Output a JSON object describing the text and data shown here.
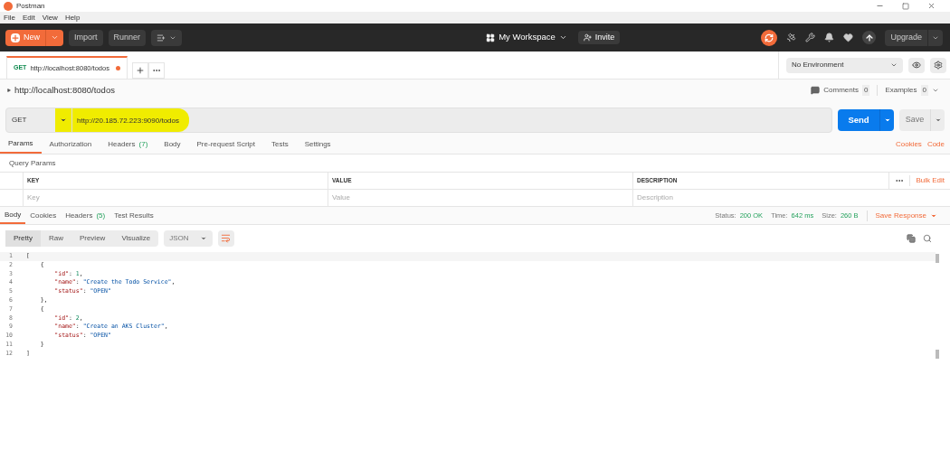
{
  "window": {
    "title": "Postman"
  },
  "menu": [
    "File",
    "Edit",
    "View",
    "Help"
  ],
  "toolbar": {
    "new": "New",
    "import": "Import",
    "runner": "Runner",
    "workspace": "My Workspace",
    "invite": "Invite",
    "upgrade": "Upgrade"
  },
  "request_tabs": [
    {
      "method": "GET",
      "url": "http://localhost:8080/todos",
      "selected": true,
      "unsaved": true
    }
  ],
  "environment": "No Environment",
  "request_title": "http://localhost:8080/todos",
  "comments": {
    "label": "Comments",
    "count": "0"
  },
  "examples": {
    "label": "Examples",
    "count": "0"
  },
  "request": {
    "method": "GET",
    "url": "http://20.185.72.223:9090/todos",
    "highlighted": true
  },
  "send": "Send",
  "save": "Save",
  "request_sections": [
    {
      "label": "Params",
      "selected": true
    },
    {
      "label": "Authorization",
      "selected": false
    },
    {
      "label": "Headers",
      "count": "(7)",
      "selected": false
    },
    {
      "label": "Body",
      "selected": false
    },
    {
      "label": "Pre-request Script",
      "selected": false
    },
    {
      "label": "Tests",
      "selected": false
    },
    {
      "label": "Settings",
      "selected": false
    }
  ],
  "section_links": [
    "Cookies",
    "Code"
  ],
  "query_params": {
    "title": "Query Params",
    "columns": [
      "KEY",
      "VALUE",
      "DESCRIPTION"
    ],
    "placeholders": [
      "Key",
      "Value",
      "Description"
    ],
    "bulk_edit": "Bulk Edit"
  },
  "response_tabs": [
    {
      "label": "Body",
      "selected": true
    },
    {
      "label": "Cookies",
      "selected": false
    },
    {
      "label": "Headers",
      "count": "(5)",
      "selected": false
    },
    {
      "label": "Test Results",
      "selected": false
    }
  ],
  "response_meta": [
    {
      "label": "Status:",
      "value": "200 OK"
    },
    {
      "label": "Time:",
      "value": "642 ms"
    },
    {
      "label": "Size:",
      "value": "260 B"
    }
  ],
  "save_response": "Save Response",
  "view_modes": [
    {
      "label": "Pretty",
      "selected": true
    },
    {
      "label": "Raw",
      "selected": false
    },
    {
      "label": "Preview",
      "selected": false
    },
    {
      "label": "Visualize",
      "selected": false
    }
  ],
  "format": "JSON",
  "code": [
    {
      "number": "1",
      "tokens": [
        {
          "kind": "punct",
          "text": "["
        }
      ]
    },
    {
      "number": "2",
      "tokens": [
        {
          "kind": "punct",
          "text": "    {"
        }
      ]
    },
    {
      "number": "3",
      "tokens": [
        {
          "kind": "key",
          "text": "        \"id\""
        },
        {
          "kind": "punct",
          "text": ": "
        },
        {
          "kind": "num",
          "text": "1"
        },
        {
          "kind": "punct",
          "text": ","
        }
      ]
    },
    {
      "number": "4",
      "tokens": [
        {
          "kind": "key",
          "text": "        \"name\""
        },
        {
          "kind": "punct",
          "text": ": "
        },
        {
          "kind": "str",
          "text": "\"Create the Todo Service\""
        },
        {
          "kind": "punct",
          "text": ","
        }
      ]
    },
    {
      "number": "5",
      "tokens": [
        {
          "kind": "key",
          "text": "        \"status\""
        },
        {
          "kind": "punct",
          "text": ": "
        },
        {
          "kind": "str",
          "text": "\"OPEN\""
        }
      ]
    },
    {
      "number": "6",
      "tokens": [
        {
          "kind": "punct",
          "text": "    },"
        }
      ]
    },
    {
      "number": "7",
      "tokens": [
        {
          "kind": "punct",
          "text": "    {"
        }
      ]
    },
    {
      "number": "8",
      "tokens": [
        {
          "kind": "key",
          "text": "        \"id\""
        },
        {
          "kind": "punct",
          "text": ": "
        },
        {
          "kind": "num",
          "text": "2"
        },
        {
          "kind": "punct",
          "text": ","
        }
      ]
    },
    {
      "number": "9",
      "tokens": [
        {
          "kind": "key",
          "text": "        \"name\""
        },
        {
          "kind": "punct",
          "text": ": "
        },
        {
          "kind": "str",
          "text": "\"Create an AKS Cluster\""
        },
        {
          "kind": "punct",
          "text": ","
        }
      ]
    },
    {
      "number": "10",
      "tokens": [
        {
          "kind": "key",
          "text": "        \"status\""
        },
        {
          "kind": "punct",
          "text": ": "
        },
        {
          "kind": "str",
          "text": "\"OPEN\""
        }
      ]
    },
    {
      "number": "11",
      "tokens": [
        {
          "kind": "punct",
          "text": "    }"
        }
      ]
    },
    {
      "number": "12",
      "tokens": [
        {
          "kind": "punct",
          "text": "]"
        }
      ]
    }
  ]
}
